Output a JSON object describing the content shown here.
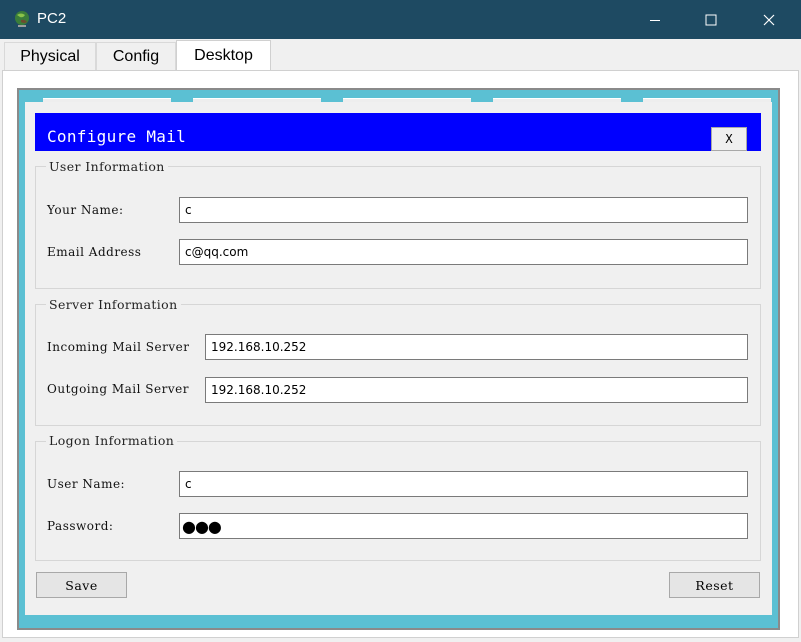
{
  "window": {
    "title": "PC2",
    "icon": "pc-globe-icon",
    "controls": [
      "minimize-icon",
      "maximize-icon",
      "close-icon"
    ]
  },
  "tabs": [
    {
      "label": "Physical",
      "active": false
    },
    {
      "label": "Config",
      "active": false
    },
    {
      "label": "Desktop",
      "active": true
    }
  ],
  "dialog": {
    "title": "Configure Mail",
    "close_label": "X",
    "header_color": "#0000ff",
    "frame_color": "#5bc0d3",
    "user_info": {
      "legend": "User Information",
      "name_label": "Your Name:",
      "name_value": "c",
      "email_label": "Email Address",
      "email_value": "c@qq.com"
    },
    "server_info": {
      "legend": "Server Information",
      "incoming_label": "Incoming Mail Server",
      "incoming_value": "192.168.10.252",
      "outgoing_label": "Outgoing Mail Server",
      "outgoing_value": "192.168.10.252"
    },
    "logon_info": {
      "legend": "Logon Information",
      "username_label": "User Name:",
      "username_value": "c",
      "password_label": "Password:",
      "password_masked": "●●●"
    },
    "save_label": "Save",
    "reset_label": "Reset"
  }
}
